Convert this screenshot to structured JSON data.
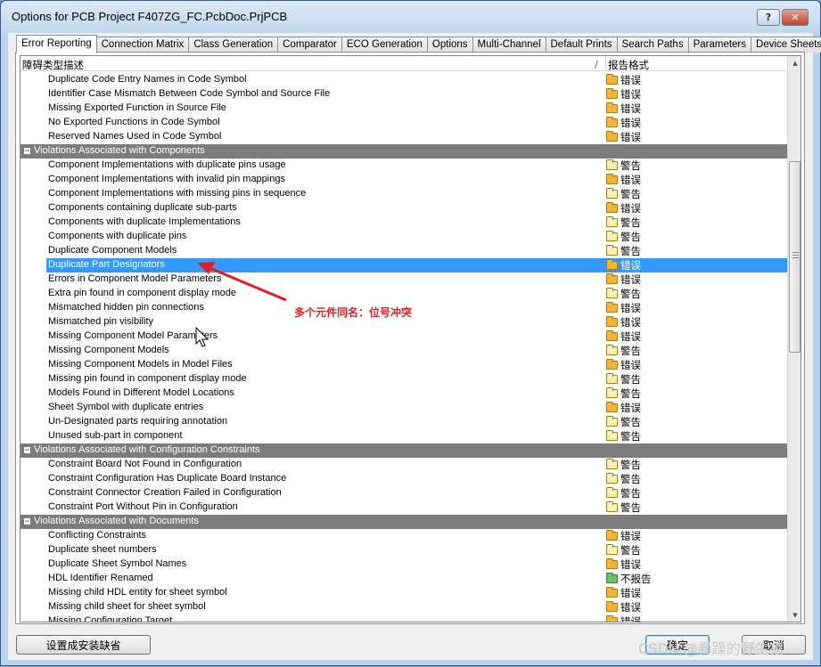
{
  "window": {
    "title": "Options for PCB Project F407ZG_FC.PcbDoc.PrjPCB",
    "help_label": "?",
    "close_label": "✕"
  },
  "tabs": [
    {
      "label": "Error Reporting",
      "active": true
    },
    {
      "label": "Connection Matrix",
      "active": false
    },
    {
      "label": "Class Generation",
      "active": false
    },
    {
      "label": "Comparator",
      "active": false
    },
    {
      "label": "ECO Generation",
      "active": false
    },
    {
      "label": "Options",
      "active": false
    },
    {
      "label": "Multi-Channel",
      "active": false
    },
    {
      "label": "Default Prints",
      "active": false
    },
    {
      "label": "Search Paths",
      "active": false
    },
    {
      "label": "Parameters",
      "active": false
    },
    {
      "label": "Device Sheets",
      "active": false
    }
  ],
  "grid": {
    "col1_header": "障碍类型描述",
    "sort_indicator": "/",
    "col2_header": "报告格式",
    "rows": [
      {
        "type": "item",
        "name": "Duplicate Code Entry Names in Code Symbol",
        "report": "错误",
        "level": "err"
      },
      {
        "type": "item",
        "name": "Identifier Case Mismatch Between Code Symbol and Source File",
        "report": "错误",
        "level": "err"
      },
      {
        "type": "item",
        "name": "Missing Exported Function in Source File",
        "report": "错误",
        "level": "err"
      },
      {
        "type": "item",
        "name": "No Exported Functions in Code Symbol",
        "report": "错误",
        "level": "err"
      },
      {
        "type": "item",
        "name": "Reserved Names Used in Code Symbol",
        "report": "错误",
        "level": "err"
      },
      {
        "type": "group",
        "name": "Violations Associated with Components",
        "toggle": "−"
      },
      {
        "type": "item",
        "name": "Component Implementations with duplicate pins usage",
        "report": "警告",
        "level": "warn"
      },
      {
        "type": "item",
        "name": "Component Implementations with invalid pin mappings",
        "report": "错误",
        "level": "err"
      },
      {
        "type": "item",
        "name": "Component Implementations with missing pins in sequence",
        "report": "警告",
        "level": "warn"
      },
      {
        "type": "item",
        "name": "Components containing duplicate sub-parts",
        "report": "错误",
        "level": "err"
      },
      {
        "type": "item",
        "name": "Components with duplicate Implementations",
        "report": "警告",
        "level": "warn"
      },
      {
        "type": "item",
        "name": "Components with duplicate pins",
        "report": "警告",
        "level": "warn"
      },
      {
        "type": "item",
        "name": "Duplicate Component Models",
        "report": "警告",
        "level": "warn"
      },
      {
        "type": "item",
        "name": "Duplicate Part Designators",
        "report": "错误",
        "level": "err",
        "selected": true
      },
      {
        "type": "item",
        "name": "Errors in Component Model Parameters",
        "report": "错误",
        "level": "err"
      },
      {
        "type": "item",
        "name": "Extra pin found in component display mode",
        "report": "警告",
        "level": "warn"
      },
      {
        "type": "item",
        "name": "Mismatched hidden pin connections",
        "report": "错误",
        "level": "err"
      },
      {
        "type": "item",
        "name": "Mismatched pin visibility",
        "report": "错误",
        "level": "err"
      },
      {
        "type": "item",
        "name": "Missing Component Model Parameters",
        "report": "错误",
        "level": "err"
      },
      {
        "type": "item",
        "name": "Missing Component Models",
        "report": "警告",
        "level": "warn"
      },
      {
        "type": "item",
        "name": "Missing Component Models in Model Files",
        "report": "错误",
        "level": "err"
      },
      {
        "type": "item",
        "name": "Missing pin found in component display mode",
        "report": "警告",
        "level": "warn"
      },
      {
        "type": "item",
        "name": "Models Found in Different Model Locations",
        "report": "警告",
        "level": "warn"
      },
      {
        "type": "item",
        "name": "Sheet Symbol with duplicate entries",
        "report": "错误",
        "level": "err"
      },
      {
        "type": "item",
        "name": "Un-Designated parts requiring annotation",
        "report": "警告",
        "level": "warn"
      },
      {
        "type": "item",
        "name": "Unused sub-part in component",
        "report": "警告",
        "level": "warn"
      },
      {
        "type": "group",
        "name": "Violations Associated with Configuration Constraints",
        "toggle": "−"
      },
      {
        "type": "item",
        "name": "Constraint Board Not Found in Configuration",
        "report": "警告",
        "level": "warn"
      },
      {
        "type": "item",
        "name": "Constraint Configuration Has Duplicate Board Instance",
        "report": "警告",
        "level": "warn"
      },
      {
        "type": "item",
        "name": "Constraint Connector Creation Failed in Configuration",
        "report": "警告",
        "level": "warn"
      },
      {
        "type": "item",
        "name": "Constraint Port Without Pin in Configuration",
        "report": "警告",
        "level": "warn"
      },
      {
        "type": "group",
        "name": "Violations Associated with Documents",
        "toggle": "−"
      },
      {
        "type": "item",
        "name": "Conflicting Constraints",
        "report": "错误",
        "level": "err"
      },
      {
        "type": "item",
        "name": "Duplicate sheet numbers",
        "report": "警告",
        "level": "warn"
      },
      {
        "type": "item",
        "name": "Duplicate Sheet Symbol Names",
        "report": "错误",
        "level": "err"
      },
      {
        "type": "item",
        "name": "HDL Identifier Renamed",
        "report": "不报告",
        "level": "none"
      },
      {
        "type": "item",
        "name": "Missing child HDL entity for sheet symbol",
        "report": "错误",
        "level": "err"
      },
      {
        "type": "item",
        "name": "Missing child sheet for sheet symbol",
        "report": "错误",
        "level": "err"
      },
      {
        "type": "item",
        "name": "Missing Configuration Target",
        "report": "错误",
        "level": "err"
      }
    ]
  },
  "scrollbar": {
    "up_arrow": "▲",
    "down_arrow": "▼"
  },
  "annotation": {
    "text": "多个元件同名：位号冲突",
    "color": "#e02020"
  },
  "buttons": {
    "set_defaults": "设置成安装缺省",
    "ok": "确定",
    "cancel": "取消"
  },
  "watermark": "CSDN @暴躁的野生猿",
  "colors": {
    "selection": "#3399ff",
    "group_row": "#7c7c7c",
    "error_folder": "#f0b636",
    "warning_folder": "#fff3bd",
    "no_report_folder": "#6bbf6b"
  }
}
